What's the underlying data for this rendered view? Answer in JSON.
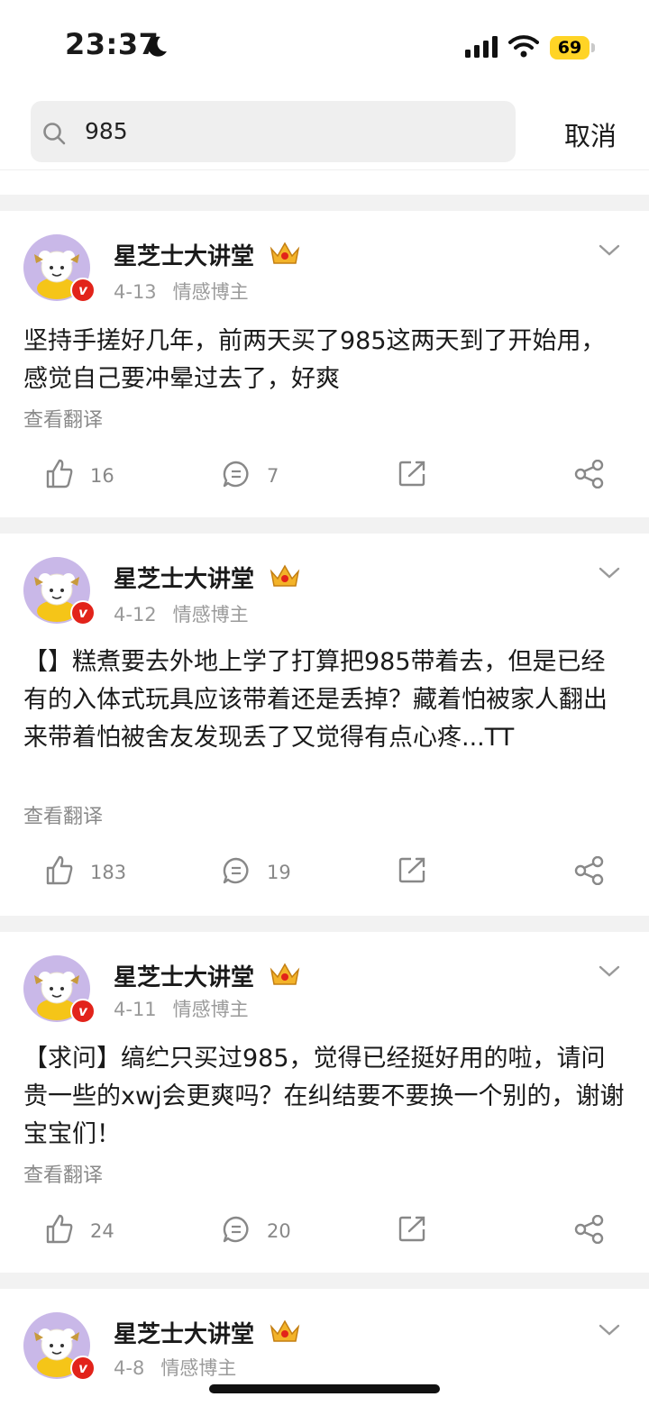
{
  "status_bar": {
    "time": "23:37",
    "battery": "69",
    "icons": [
      "moon-icon",
      "signal-icon",
      "wifi-icon",
      "battery-icon"
    ]
  },
  "search": {
    "query": "985",
    "cancel_label": "取消"
  },
  "posts": [
    {
      "author": "星芝士大讲堂",
      "date": "4-13",
      "tag": "情感博主",
      "text": "坚持手搓好几年，前两天买了985这两天到了开始用，感觉自己要冲晕过去了，好爽",
      "translate_label": "查看翻译",
      "likes": "16",
      "comments": "7"
    },
    {
      "author": "星芝士大讲堂",
      "date": "4-12",
      "tag": "情感博主",
      "text": "【】糕煮要去外地上学了打算把985带着去，但是已经有的入体式玩具应该带着还是丢掉？藏着怕被家人翻出来带着怕被舍友发现丢了又觉得有点心疼...TT",
      "translate_label": "查看翻译",
      "likes": "183",
      "comments": "19"
    },
    {
      "author": "星芝士大讲堂",
      "date": "4-11",
      "tag": "情感博主",
      "text": "【求问】缟纻只买过985，觉得已经挺好用的啦，请问贵一些的xwj会更爽吗？在纠结要不要换一个别的，谢谢宝宝们！",
      "translate_label": "查看翻译",
      "likes": "24",
      "comments": "20"
    },
    {
      "author": "星芝士大讲堂",
      "date": "4-8",
      "tag": "情感博主"
    }
  ],
  "colors": {
    "accent_badge": "#e2231a",
    "battery": "#ffd426",
    "divider": "#f2f2f2"
  }
}
